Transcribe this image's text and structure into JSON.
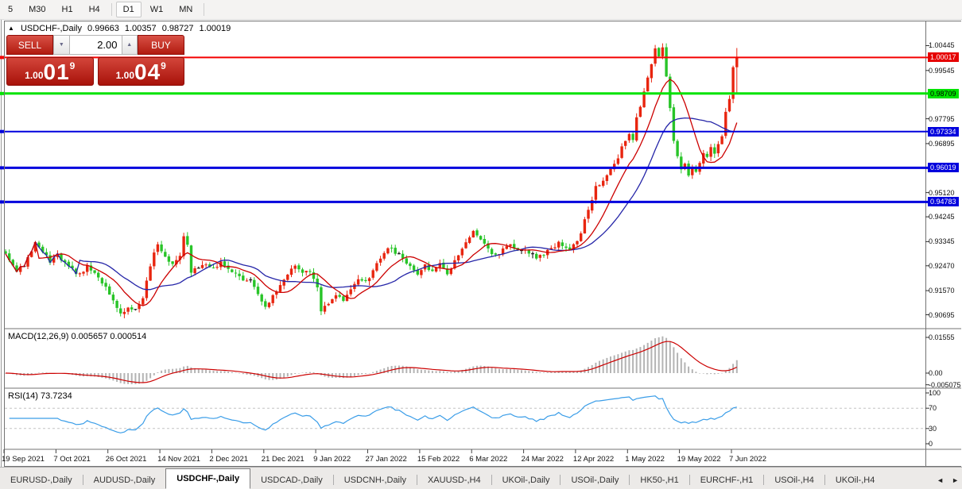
{
  "toolbar": {
    "items": [
      "5",
      "M30",
      "H1",
      "H4",
      "D1",
      "W1",
      "MN"
    ],
    "active_index": 4
  },
  "title": {
    "icon": "▲",
    "symbol": "USDCHF-,Daily",
    "open": "0.99663",
    "high": "1.00357",
    "low": "0.98727",
    "close": "1.00019"
  },
  "trade_panel": {
    "sell_label": "SELL",
    "buy_label": "BUY",
    "volume": "2.00",
    "spin_down": "▼",
    "spin_up": "▲",
    "sell_price_prefix": "1.00",
    "sell_price_big": "01",
    "sell_price_sup": "9",
    "buy_price_prefix": "1.00",
    "buy_price_big": "04",
    "buy_price_sup": "9"
  },
  "price_axis": {
    "plain": [
      {
        "text": "1.00445",
        "price": 1.00445
      },
      {
        "text": "0.99545",
        "price": 0.99545
      },
      {
        "text": "0.97795",
        "price": 0.97795
      },
      {
        "text": "0.96895",
        "price": 0.96895
      },
      {
        "text": "0.95120",
        "price": 0.9512
      },
      {
        "text": "0.94245",
        "price": 0.94245
      },
      {
        "text": "0.93345",
        "price": 0.93345
      },
      {
        "text": "0.92470",
        "price": 0.9247
      },
      {
        "text": "0.91570",
        "price": 0.9157
      },
      {
        "text": "0.90695",
        "price": 0.90695
      }
    ],
    "badges": [
      {
        "text": "1.00017",
        "price": 1.00017,
        "style": "red"
      },
      {
        "text": "0.98709",
        "price": 0.98709,
        "style": "green"
      },
      {
        "text": "0.97334",
        "price": 0.97334,
        "style": "blue"
      },
      {
        "text": "0.96019",
        "price": 0.96019,
        "style": "blue"
      },
      {
        "text": "0.94783",
        "price": 0.94783,
        "style": "blue"
      }
    ]
  },
  "chart_data": {
    "type": "candlestick",
    "symbol": "USDCHF",
    "timeframe": "Daily",
    "bar_count": 198,
    "price_range": {
      "max": 1.0135,
      "min": 0.9025
    },
    "colors": {
      "bull": "#e8250f",
      "bear": "#28c428",
      "ma_fast": "#cc0000",
      "ma_slow": "#2525a8",
      "macd_hist": "#b4b4b4",
      "macd_signal": "#cc0000",
      "rsi_line": "#3a9de8",
      "level_red": "#f40000",
      "level_green": "#00e300",
      "level_blue": "#0000dd"
    },
    "levels": [
      {
        "price": 1.00017,
        "color": "#f40000",
        "width": 2
      },
      {
        "price": 0.98709,
        "color": "#00e300",
        "width": 3
      },
      {
        "price": 0.97334,
        "color": "#0000dd",
        "width": 2
      },
      {
        "price": 0.96019,
        "color": "#0000dd",
        "width": 3
      },
      {
        "price": 0.94783,
        "color": "#0000dd",
        "width": 3
      }
    ],
    "close_waypoints": [
      [
        0,
        0.9285
      ],
      [
        3,
        0.9228
      ],
      [
        5,
        0.9248
      ],
      [
        8,
        0.9335
      ],
      [
        10,
        0.9298
      ],
      [
        12,
        0.9262
      ],
      [
        14,
        0.9288
      ],
      [
        17,
        0.9246
      ],
      [
        20,
        0.9213
      ],
      [
        22,
        0.9243
      ],
      [
        25,
        0.9206
      ],
      [
        27,
        0.9166
      ],
      [
        29,
        0.9126
      ],
      [
        31,
        0.9073
      ],
      [
        33,
        0.9096
      ],
      [
        35,
        0.9083
      ],
      [
        37,
        0.9136
      ],
      [
        40,
        0.929
      ],
      [
        41,
        0.9322
      ],
      [
        43,
        0.9277
      ],
      [
        45,
        0.9254
      ],
      [
        47,
        0.9282
      ],
      [
        48,
        0.9352
      ],
      [
        49,
        0.9329
      ],
      [
        50,
        0.9223
      ],
      [
        52,
        0.9241
      ],
      [
        54,
        0.9257
      ],
      [
        56,
        0.9239
      ],
      [
        58,
        0.9261
      ],
      [
        60,
        0.9236
      ],
      [
        63,
        0.9206
      ],
      [
        66,
        0.9189
      ],
      [
        68,
        0.9143
      ],
      [
        70,
        0.9097
      ],
      [
        72,
        0.9139
      ],
      [
        74,
        0.9181
      ],
      [
        76,
        0.9221
      ],
      [
        78,
        0.9243
      ],
      [
        80,
        0.9219
      ],
      [
        82,
        0.9231
      ],
      [
        84,
        0.9169
      ],
      [
        85,
        0.9089
      ],
      [
        87,
        0.9113
      ],
      [
        89,
        0.9141
      ],
      [
        91,
        0.9123
      ],
      [
        93,
        0.9161
      ],
      [
        95,
        0.9201
      ],
      [
        97,
        0.9186
      ],
      [
        99,
        0.9231
      ],
      [
        101,
        0.9271
      ],
      [
        103,
        0.9311
      ],
      [
        106,
        0.9287
      ],
      [
        108,
        0.9257
      ],
      [
        111,
        0.9219
      ],
      [
        113,
        0.9247
      ],
      [
        115,
        0.9223
      ],
      [
        117,
        0.9261
      ],
      [
        119,
        0.9219
      ],
      [
        121,
        0.9261
      ],
      [
        123,
        0.9304
      ],
      [
        126,
        0.9379
      ],
      [
        128,
        0.9341
      ],
      [
        130,
        0.9306
      ],
      [
        132,
        0.9283
      ],
      [
        134,
        0.9309
      ],
      [
        136,
        0.9329
      ],
      [
        138,
        0.9303
      ],
      [
        140,
        0.9309
      ],
      [
        143,
        0.9272
      ],
      [
        146,
        0.9299
      ],
      [
        149,
        0.9329
      ],
      [
        152,
        0.9311
      ],
      [
        154,
        0.9341
      ],
      [
        155,
        0.9371
      ],
      [
        157,
        0.9449
      ],
      [
        159,
        0.9529
      ],
      [
        161,
        0.9561
      ],
      [
        163,
        0.9601
      ],
      [
        165,
        0.9641
      ],
      [
        166,
        0.9679
      ],
      [
        168,
        0.9721
      ],
      [
        169,
        0.9701
      ],
      [
        170,
        0.9779
      ],
      [
        172,
        0.9879
      ],
      [
        174,
        0.9979
      ],
      [
        175,
        1.0029
      ],
      [
        176,
        1.0011
      ],
      [
        177,
        1.0036
      ],
      [
        178,
        0.9936
      ],
      [
        179,
        0.9821
      ],
      [
        180,
        0.9701
      ],
      [
        181,
        0.9641
      ],
      [
        182,
        0.9601
      ],
      [
        183,
        0.9621
      ],
      [
        184,
        0.9577
      ],
      [
        185,
        0.9606
      ],
      [
        186,
        0.9581
      ],
      [
        187,
        0.9621
      ],
      [
        188,
        0.9661
      ],
      [
        189,
        0.9641
      ],
      [
        190,
        0.9681
      ],
      [
        191,
        0.9657
      ],
      [
        192,
        0.9691
      ],
      [
        193,
        0.9721
      ],
      [
        194,
        0.9801
      ],
      [
        195,
        0.9851
      ],
      [
        196,
        0.99663
      ],
      [
        197,
        1.00019
      ]
    ],
    "last_candle": {
      "o": 0.99663,
      "h": 1.00357,
      "l": 0.98727,
      "c": 1.00019
    },
    "moving_averages": [
      {
        "period": 10,
        "color": "#cc0000"
      },
      {
        "period": 21,
        "color": "#2525a8"
      }
    ],
    "x_labels": [
      "19 Sep 2021",
      "7 Oct 2021",
      "26 Oct 2021",
      "14 Nov 2021",
      "2 Dec 2021",
      "21 Dec 2021",
      "9 Jan 2022",
      "27 Jan 2022",
      "15 Feb 2022",
      "6 Mar 2022",
      "24 Mar 2022",
      "12 Apr 2022",
      "1 May 2022",
      "19 May 2022",
      "7 Jun 2022"
    ],
    "indicators": {
      "macd": {
        "label": "MACD(12,26,9) 0.005657 0.000514",
        "fast": 12,
        "slow": 26,
        "signal": 9,
        "axis_labels": [
          {
            "text": "0.01555",
            "v": 0.01555
          },
          {
            "text": "0.00",
            "v": 0
          },
          {
            "text": "-0.005075",
            "v": -0.005075
          }
        ]
      },
      "rsi": {
        "label": "RSI(14) 73.7234",
        "period": 14,
        "axis_labels": [
          {
            "text": "100",
            "v": 100
          },
          {
            "text": "70",
            "v": 70
          },
          {
            "text": "30",
            "v": 30
          },
          {
            "text": "0",
            "v": 0
          }
        ],
        "dashed_levels": [
          70,
          30
        ]
      }
    }
  },
  "tabs": {
    "items": [
      "EURUSD-,Daily",
      "AUDUSD-,Daily",
      "USDCHF-,Daily",
      "USDCAD-,Daily",
      "USDCNH-,Daily",
      "XAUUSD-,H4",
      "UKOil-,Daily",
      "USOil-,Daily",
      "HK50-,H1",
      "EURCHF-,H1",
      "USOil-,H4",
      "UKOil-,H4"
    ],
    "active_index": 2,
    "scroll_left": "◄",
    "scroll_right": "►"
  }
}
